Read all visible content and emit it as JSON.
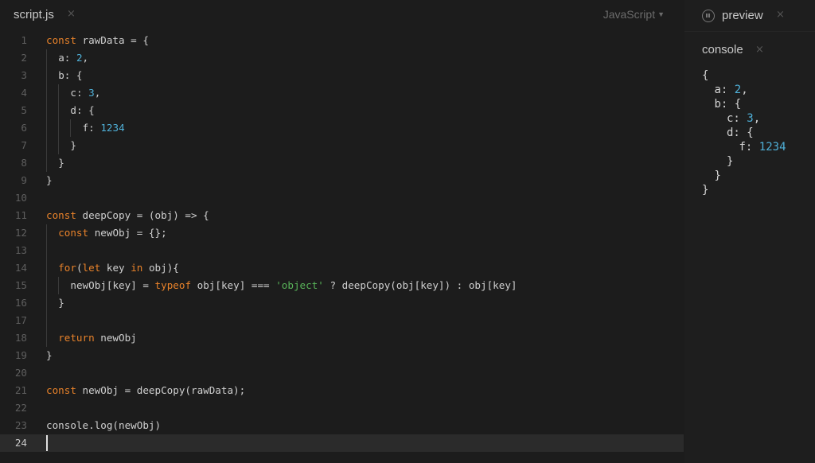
{
  "editor": {
    "tab_title": "script.js",
    "tab_close": "×",
    "language": "JavaScript",
    "active_line": 24,
    "lines": [
      {
        "n": "1",
        "indent": 0,
        "tokens": [
          [
            "kw",
            "const"
          ],
          [
            "p",
            " rawData = {"
          ]
        ]
      },
      {
        "n": "2",
        "indent": 1,
        "tokens": [
          [
            "p",
            "a: "
          ],
          [
            "num",
            "2"
          ],
          [
            "p",
            ","
          ]
        ]
      },
      {
        "n": "3",
        "indent": 1,
        "tokens": [
          [
            "p",
            "b: {"
          ]
        ]
      },
      {
        "n": "4",
        "indent": 2,
        "tokens": [
          [
            "p",
            "c: "
          ],
          [
            "num",
            "3"
          ],
          [
            "p",
            ","
          ]
        ]
      },
      {
        "n": "5",
        "indent": 2,
        "tokens": [
          [
            "p",
            "d: {"
          ]
        ]
      },
      {
        "n": "6",
        "indent": 3,
        "tokens": [
          [
            "p",
            "f: "
          ],
          [
            "num",
            "1234"
          ]
        ]
      },
      {
        "n": "7",
        "indent": 2,
        "tokens": [
          [
            "p",
            "}"
          ]
        ]
      },
      {
        "n": "8",
        "indent": 1,
        "tokens": [
          [
            "p",
            "}"
          ]
        ]
      },
      {
        "n": "9",
        "indent": 0,
        "tokens": [
          [
            "p",
            "}"
          ]
        ]
      },
      {
        "n": "10",
        "indent": 0,
        "tokens": []
      },
      {
        "n": "11",
        "indent": 0,
        "tokens": [
          [
            "kw",
            "const"
          ],
          [
            "p",
            " deepCopy = (obj) => {"
          ]
        ]
      },
      {
        "n": "12",
        "indent": 1,
        "tokens": [
          [
            "kw",
            "const"
          ],
          [
            "p",
            " newObj = {};"
          ]
        ]
      },
      {
        "n": "13",
        "indent": 1,
        "tokens": []
      },
      {
        "n": "14",
        "indent": 1,
        "tokens": [
          [
            "kw",
            "for"
          ],
          [
            "p",
            "("
          ],
          [
            "kw",
            "let"
          ],
          [
            "p",
            " key "
          ],
          [
            "kw",
            "in"
          ],
          [
            "p",
            " obj){"
          ]
        ]
      },
      {
        "n": "15",
        "indent": 2,
        "tokens": [
          [
            "p",
            "newObj[key] = "
          ],
          [
            "kw",
            "typeof"
          ],
          [
            "p",
            " obj[key] === "
          ],
          [
            "str",
            "'object'"
          ],
          [
            "p",
            " ? deepCopy(obj[key]) : obj[key]"
          ]
        ]
      },
      {
        "n": "16",
        "indent": 1,
        "tokens": [
          [
            "p",
            "}"
          ]
        ]
      },
      {
        "n": "17",
        "indent": 1,
        "tokens": []
      },
      {
        "n": "18",
        "indent": 1,
        "tokens": [
          [
            "kw",
            "return"
          ],
          [
            "p",
            " newObj"
          ]
        ]
      },
      {
        "n": "19",
        "indent": 0,
        "tokens": [
          [
            "p",
            "}"
          ]
        ]
      },
      {
        "n": "20",
        "indent": 0,
        "tokens": []
      },
      {
        "n": "21",
        "indent": 0,
        "tokens": [
          [
            "kw",
            "const"
          ],
          [
            "p",
            " newObj = deepCopy(rawData);"
          ]
        ]
      },
      {
        "n": "22",
        "indent": 0,
        "tokens": []
      },
      {
        "n": "23",
        "indent": 0,
        "tokens": [
          [
            "p",
            "console.log(newObj)"
          ]
        ]
      },
      {
        "n": "24",
        "indent": 0,
        "tokens": []
      }
    ]
  },
  "preview": {
    "tab_label": "preview",
    "tab_close": "×",
    "pause_icon": "pause-circle-icon",
    "console_label": "console",
    "console_close": "×",
    "output": [
      {
        "indent": 0,
        "tokens": [
          [
            "p",
            "{"
          ]
        ]
      },
      {
        "indent": 1,
        "tokens": [
          [
            "p",
            "a: "
          ],
          [
            "num",
            "2"
          ],
          [
            "p",
            ","
          ]
        ]
      },
      {
        "indent": 1,
        "tokens": [
          [
            "p",
            "b: {"
          ]
        ]
      },
      {
        "indent": 2,
        "tokens": [
          [
            "p",
            "c: "
          ],
          [
            "num",
            "3"
          ],
          [
            "p",
            ","
          ]
        ]
      },
      {
        "indent": 2,
        "tokens": [
          [
            "p",
            "d: {"
          ]
        ]
      },
      {
        "indent": 3,
        "tokens": [
          [
            "p",
            "f: "
          ],
          [
            "num",
            "1234"
          ]
        ]
      },
      {
        "indent": 2,
        "tokens": [
          [
            "p",
            "}"
          ]
        ]
      },
      {
        "indent": 1,
        "tokens": [
          [
            "p",
            "}"
          ]
        ]
      },
      {
        "indent": 0,
        "tokens": [
          [
            "p",
            "}"
          ]
        ]
      }
    ]
  },
  "colors": {
    "keyword": "#e8822a",
    "number": "#4fb0d8",
    "string": "#58b359",
    "background": "#1c1c1c"
  }
}
